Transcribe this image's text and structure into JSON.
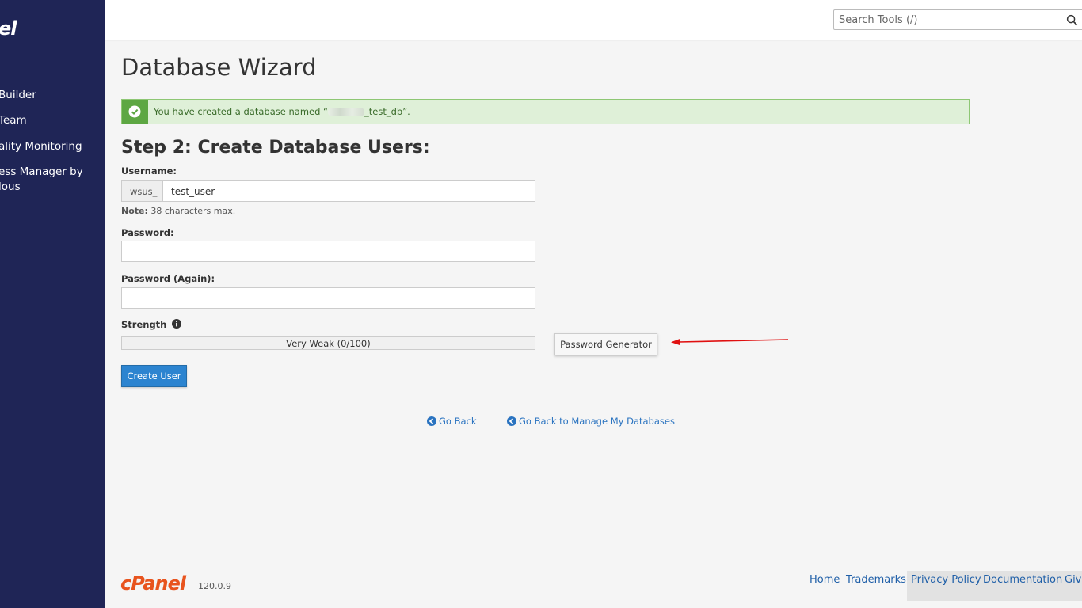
{
  "sidebar": {
    "logo_fragment": "el",
    "items": [
      {
        "label": "Builder"
      },
      {
        "label": "Team"
      },
      {
        "label": "ality Monitoring"
      },
      {
        "label": "ess Manager by"
      },
      {
        "label": "lous"
      }
    ]
  },
  "search": {
    "placeholder": "Search Tools (/)",
    "icon": "search-icon"
  },
  "page": {
    "title": "Database Wizard"
  },
  "alert": {
    "icon": "check-circle-icon",
    "text_before": "You have created a database named “",
    "text_after": "_test_db”.",
    "color": "#dff0d8"
  },
  "step": {
    "heading": "Step 2: Create Database Users:"
  },
  "form": {
    "username_label": "Username:",
    "username_prefix": "wsus_",
    "username_value": "test_user",
    "note_label": "Note:",
    "note_text": " 38 characters max.",
    "password_label": "Password:",
    "password_value": "",
    "password_again_label": "Password (Again):",
    "password_again_value": "",
    "strength_label": "Strength",
    "strength_text": "Very Weak (0/100)",
    "strength_value": 0,
    "password_generator_label": "Password Generator",
    "create_user_label": "Create User"
  },
  "links": {
    "go_back": "Go Back",
    "go_back_manage": "Go Back to Manage My Databases"
  },
  "footer": {
    "brand": "cPanel",
    "version": "120.0.9",
    "links": [
      "Home",
      "Trademarks",
      "Privacy Policy",
      "Documentation",
      "Give"
    ]
  },
  "colors": {
    "sidebar": "#1f2556",
    "accent": "#2c84d0",
    "brand": "#e8541e",
    "arrow": "#e01010"
  }
}
